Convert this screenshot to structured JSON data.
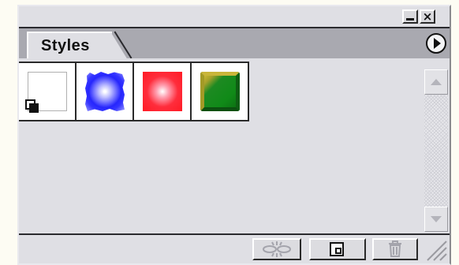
{
  "window": {
    "minimize_glyph": "_",
    "close_glyph": "×"
  },
  "tabs": [
    {
      "label": "Styles",
      "active": true
    }
  ],
  "palette_menu": {
    "icon": "circle-right-arrow-icon"
  },
  "styles": [
    {
      "id": "default",
      "swatch": "default-style-icon"
    },
    {
      "id": "blue-glow",
      "swatch": "blue-fuzzy-square",
      "color": "#3b3bff"
    },
    {
      "id": "red-glow",
      "swatch": "red-radial-square",
      "color": "#ff2d3c"
    },
    {
      "id": "green-bevel",
      "swatch": "green-bevel-square",
      "color": "#108a18"
    }
  ],
  "footer_buttons": [
    {
      "name": "break-link",
      "icon": "break-link-icon",
      "enabled": false
    },
    {
      "name": "new-style",
      "icon": "new-style-icon",
      "enabled": true
    },
    {
      "name": "delete-style",
      "icon": "trash-icon",
      "enabled": false
    }
  ],
  "colors": {
    "panel_bg": "#dfdfe4",
    "tab_strip": "#a9a9b0",
    "page_bg": "#fdfcf3"
  }
}
